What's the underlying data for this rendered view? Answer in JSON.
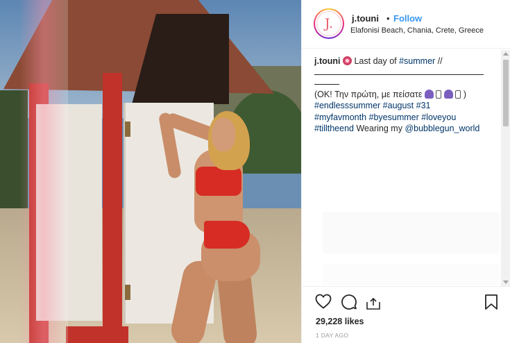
{
  "post": {
    "photo_alt": "Woman in red bikini posing by beach changing hut"
  },
  "header": {
    "avatar_letter": "J.",
    "username": "j.touni",
    "separator": "•",
    "follow_label": "Follow",
    "location": "Elafonisi Beach, Chania, Crete, Greece"
  },
  "caption": {
    "username": "j.touni",
    "line1_text": "Last day of",
    "line1_tag": "#summer",
    "line1_end": "//",
    "greek_open": "(OK! Την πρώτη, με πείσατε",
    "greek_close": ")",
    "tags_row1": [
      "#endlesssummer",
      "#august",
      "#31"
    ],
    "tags_row2": [
      "#myfavmonth",
      "#byesummer",
      "#loveyou"
    ],
    "tag_row3": "#tilltheend",
    "wearing_text": "Wearing my",
    "mention": "@bubblegun_world"
  },
  "actions": {
    "likes": "29,228 likes",
    "timestamp": "1 DAY AGO"
  },
  "icons": [
    "heart-icon",
    "comment-icon",
    "share-icon",
    "bookmark-icon"
  ],
  "colors": {
    "link": "#003569",
    "follow": "#3897f0",
    "text": "#262626",
    "muted": "#999999"
  }
}
